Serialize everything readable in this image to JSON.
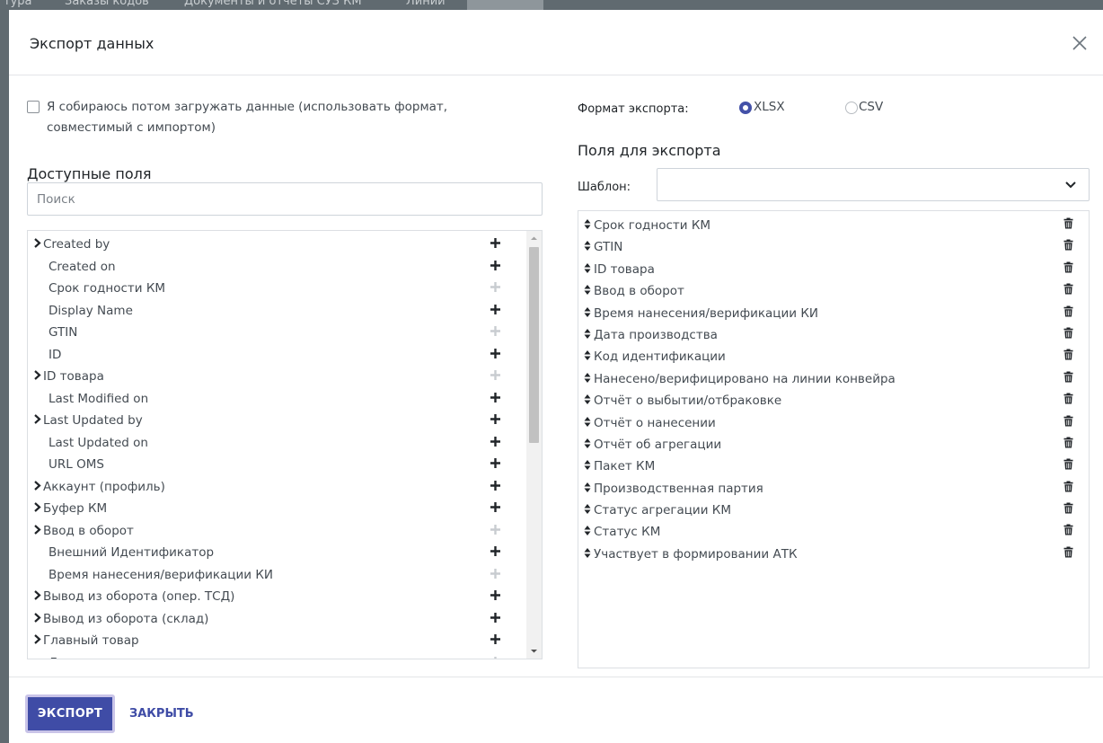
{
  "backdrop": {
    "tabs": [
      "тура",
      "Заказы кодов",
      "Документы и отчеты СУЗ КМ",
      "Линии"
    ]
  },
  "dialog": {
    "title": "Экспорт данных"
  },
  "left": {
    "import_checkbox_label": "Я собираюсь потом загружать данные (использовать формат, совместимый с импортом)",
    "available_title": "Доступные поля",
    "search_placeholder": "Поиск",
    "fields": [
      {
        "label": "Created by",
        "expandable": true,
        "added": false
      },
      {
        "label": "Created on",
        "expandable": false,
        "added": false
      },
      {
        "label": "Срок годности КМ",
        "expandable": false,
        "added": true
      },
      {
        "label": "Display Name",
        "expandable": false,
        "added": false
      },
      {
        "label": "GTIN",
        "expandable": false,
        "added": true
      },
      {
        "label": "ID",
        "expandable": false,
        "added": false
      },
      {
        "label": "ID товара",
        "expandable": true,
        "added": true
      },
      {
        "label": "Last Modified on",
        "expandable": false,
        "added": false
      },
      {
        "label": "Last Updated by",
        "expandable": true,
        "added": false
      },
      {
        "label": "Last Updated on",
        "expandable": false,
        "added": false
      },
      {
        "label": "URL OMS",
        "expandable": false,
        "added": false
      },
      {
        "label": "Аккаунт (профиль)",
        "expandable": true,
        "added": false
      },
      {
        "label": "Буфер КМ",
        "expandable": true,
        "added": false
      },
      {
        "label": "Ввод в оборот",
        "expandable": true,
        "added": true
      },
      {
        "label": "Внешний Идентификатор",
        "expandable": false,
        "added": false
      },
      {
        "label": "Время нанесения/верификации КИ",
        "expandable": false,
        "added": true
      },
      {
        "label": "Вывод из оборота (опер. ТСД)",
        "expandable": true,
        "added": false
      },
      {
        "label": "Вывод из оборота (склад)",
        "expandable": true,
        "added": false
      },
      {
        "label": "Главный товар",
        "expandable": true,
        "added": false
      },
      {
        "label": "Дата производства",
        "expandable": false,
        "added": true
      }
    ]
  },
  "right": {
    "format_label": "Формат экспорта:",
    "format_options": [
      "XLSX",
      "CSV"
    ],
    "format_selected": "XLSX",
    "export_title": "Поля для экспорта",
    "template_label": "Шаблон:",
    "template_value": "",
    "export_fields": [
      "Срок годности КМ",
      "GTIN",
      "ID товара",
      "Ввод в оборот",
      "Время нанесения/верификации КИ",
      "Дата производства",
      "Код идентификации",
      "Нанесено/верифицировано на линии конвейра",
      "Отчёт о выбытии/отбраковке",
      "Отчёт о нанесении",
      "Отчёт об агрегации",
      "Пакет КМ",
      "Производственная партия",
      "Статус агрегации КМ",
      "Статус КМ",
      "Участвует в формировании АТК"
    ]
  },
  "footer": {
    "export_button": "ЭКСПОРТ",
    "close_button": "ЗАКРЫТЬ"
  },
  "colors": {
    "accent": "#3f4ca6",
    "icon_active": "#212529",
    "icon_disabled": "#c8ccd0"
  }
}
